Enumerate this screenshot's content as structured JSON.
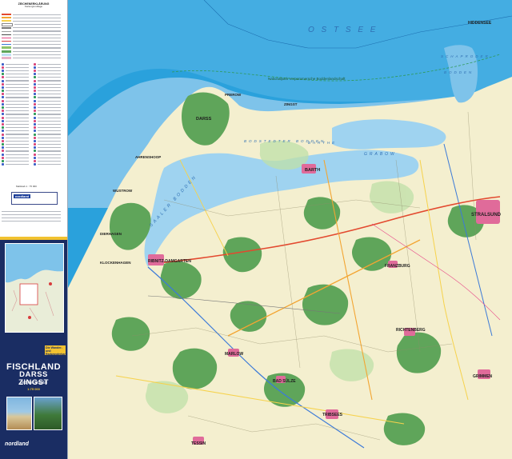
{
  "legend": {
    "title": "ZEICHENERKLÄRUNG",
    "subtitle": "Kartengrundlage",
    "scale_text": "Maßstab 1 : 75 000",
    "publisher_box": "nordland"
  },
  "cover": {
    "banner": "Die Wander- und Radwanderkarte",
    "title_line1": "FISCHLAND",
    "title_line2": "DARSS ZINGST",
    "subtitle": "und Recknitztal",
    "scale": "1:75 000",
    "logo": "nordland"
  },
  "map": {
    "sea_label": "O S T S E E",
    "colors": {
      "sea": "#2aa1dc",
      "sea_light": "#7ec3ea",
      "land": "#f4efcf",
      "forest": "#5fa55a",
      "lagoon": "#9fd3f0",
      "town": "#e06b9a"
    },
    "water_labels": [
      "BODSTEDTER BODDEN",
      "SAALER BODDEN",
      "GRABOW",
      "BARTHE",
      "BODDEN",
      "SCHAPRODER"
    ],
    "places": [
      "HIDDENSEE",
      "BARTH",
      "RIBNITZ-DAMGARTEN",
      "STRALSUND",
      "RICHTENBERG",
      "GRIMMEN",
      "TRIBSEES",
      "TESSIN",
      "MARLOW",
      "BAD SÜLZE",
      "FRANZBURG",
      "ZINGST",
      "PREROW",
      "DARSS",
      "AHRENSHOOP",
      "WUSTROW",
      "DIERHAGEN",
      "KLOCKENHAGEN"
    ],
    "park_label": "Nationalpark Vorpommersche Boddenlandschaft"
  }
}
